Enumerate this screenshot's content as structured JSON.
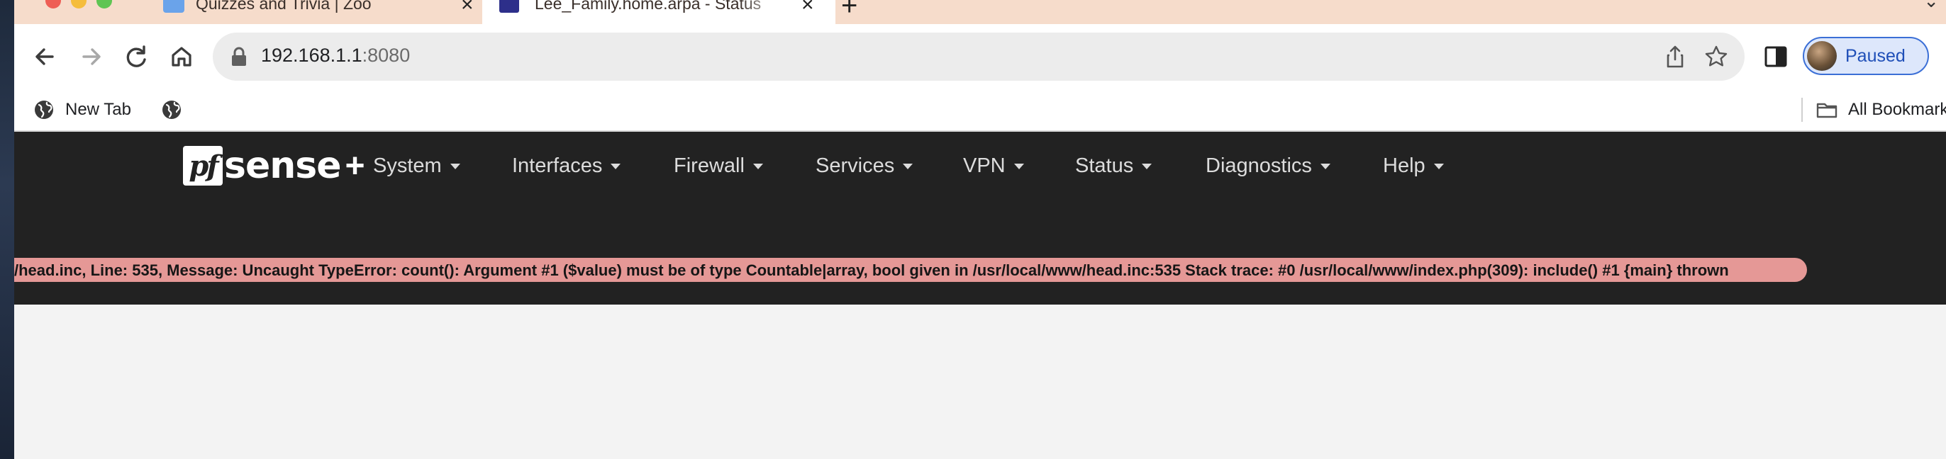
{
  "tabs": [
    {
      "title": "Quizzes and Trivia | Zoo",
      "active": false
    },
    {
      "title": "Lee_Family.home.arpa - Status",
      "active": true
    }
  ],
  "toolbar": {
    "url_host": "192.168.1.1",
    "url_port": ":8080",
    "profile_label": "Paused"
  },
  "bookmarks": {
    "items": [
      {
        "label": "New Tab"
      },
      {
        "label": ""
      }
    ],
    "all_label": "All Bookmarks"
  },
  "pfsense": {
    "brand_pf": "pf",
    "brand_sense": "sense",
    "brand_plus": "+",
    "menu": [
      {
        "label": "System"
      },
      {
        "label": "Interfaces"
      },
      {
        "label": "Firewall"
      },
      {
        "label": "Services"
      },
      {
        "label": "VPN"
      },
      {
        "label": "Status"
      },
      {
        "label": "Diagnostics"
      },
      {
        "label": "Help"
      }
    ],
    "error_message": "/head.inc, Line: 535, Message: Uncaught TypeError: count(): Argument #1 ($value) must be of type Countable|array, bool given in /usr/local/www/head.inc:535 Stack trace: #0 /usr/local/www/index.php(309): include() #1 {main} thrown"
  },
  "colors": {
    "tab_strip": "#f6dccb",
    "navbar": "#222222",
    "error_banner": "#e59896",
    "profile_accent": "#3b6fd6"
  }
}
